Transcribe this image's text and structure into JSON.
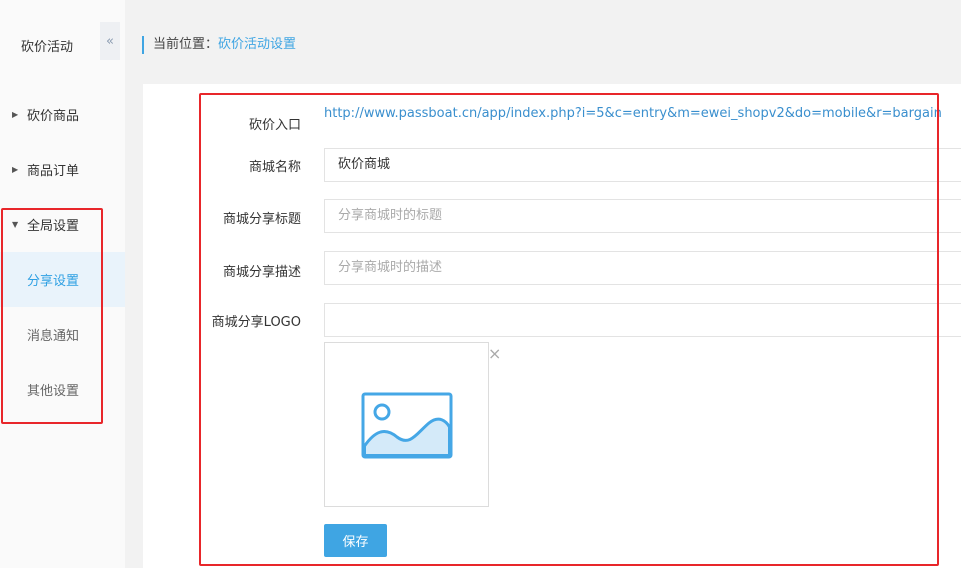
{
  "sidebar": {
    "title": "砍价活动",
    "collapse_icon": "«",
    "items": [
      {
        "label": "砍价商品"
      },
      {
        "label": "商品订单"
      },
      {
        "label": "全局设置"
      },
      {
        "label": "分享设置"
      },
      {
        "label": "消息通知"
      },
      {
        "label": "其他设置"
      }
    ]
  },
  "breadcrumb": {
    "prefix": "当前位置：",
    "current": "砍价活动设置"
  },
  "form": {
    "entry_label": "砍价入口",
    "entry_url": "http://www.passboat.cn/app/index.php?i=5&c=entry&m=ewei_shopv2&do=mobile&r=bargain",
    "name_label": "商城名称",
    "name_value": "砍价商城",
    "share_title_label": "商城分享标题",
    "share_title_placeholder": "分享商城时的标题",
    "share_desc_label": "商城分享描述",
    "share_desc_placeholder": "分享商城时的描述",
    "logo_label": "商城分享LOGO",
    "logo_value": "",
    "close_icon": "×",
    "save_label": "保存"
  },
  "colors": {
    "accent": "#3fa5e3",
    "highlight": "#e8262a"
  }
}
